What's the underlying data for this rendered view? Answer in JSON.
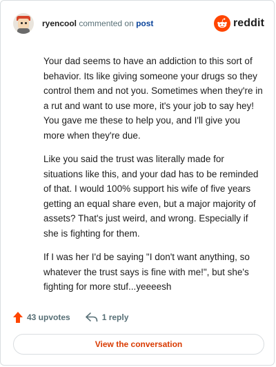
{
  "header": {
    "username": "ryencool",
    "action_text": "commented on",
    "post_link": "post",
    "brand": "reddit"
  },
  "comment": {
    "paragraphs": [
      "Your dad seems to have an addiction to this sort of behavior. Its like giving someone your drugs so they control them and not you. Sometimes when they're in a rut and want to use more, it's your job to say hey! You gave me these to help you, and I'll give you more when they're due.",
      "Like you said the trust was literally made for situations like this, and your dad has to be reminded of that. I would 100% support his wife of five years getting an equal share even, but a major majority of assets? That's just weird, and wrong. Especially if she is fighting for them.",
      "If I was her I'd be saying \"I don't want anything, so whatever the trust says is fine with me!\", but she's fighting for more stuf...yeeeesh"
    ]
  },
  "actions": {
    "upvotes": "43 upvotes",
    "replies": "1 reply"
  },
  "footer": {
    "view_button": "View the conversation"
  },
  "colors": {
    "accent": "#d93a00",
    "brand_orange": "#ff4500",
    "link_blue": "#0a449b",
    "muted": "#576f76"
  },
  "icons": {
    "upvote": "upvote-arrow-icon",
    "reply": "reply-arrow-icon",
    "logo": "snoo-icon"
  }
}
